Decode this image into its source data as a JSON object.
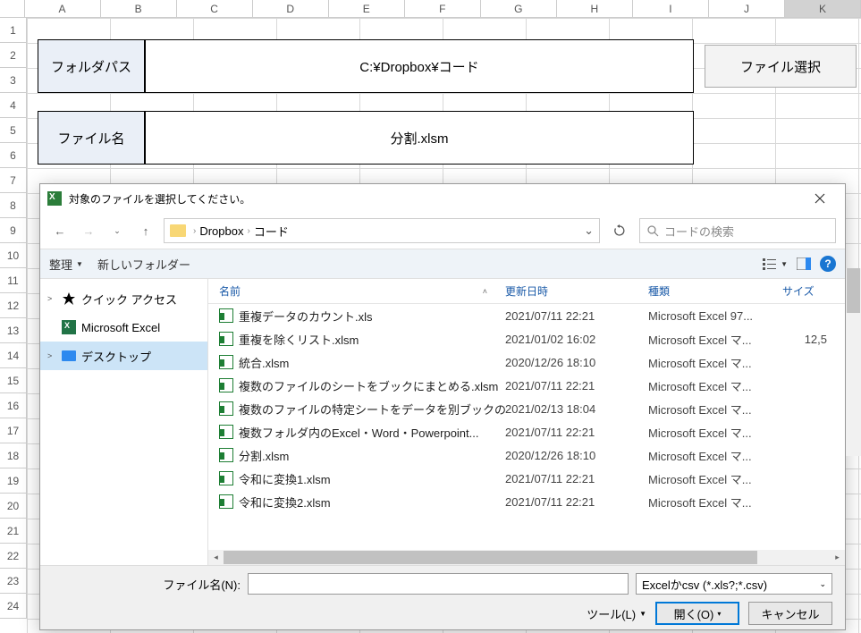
{
  "columns": [
    "A",
    "B",
    "C",
    "D",
    "E",
    "F",
    "G",
    "H",
    "I",
    "J",
    "K"
  ],
  "selected_column": "K",
  "rows": [
    "1",
    "2",
    "3",
    "4",
    "5",
    "6",
    "7",
    "8",
    "9",
    "10",
    "11",
    "12",
    "13",
    "14",
    "15",
    "16",
    "17",
    "18",
    "19",
    "20",
    "21",
    "22",
    "23",
    "24"
  ],
  "sheet": {
    "folder_path_label": "フォルダパス",
    "folder_path_value": "C:¥Dropbox¥コード",
    "file_select_button": "ファイル選択",
    "file_name_label": "ファイル名",
    "file_name_value": "分割.xlsm"
  },
  "dialog": {
    "title": "対象のファイルを選択してください。",
    "breadcrumb": {
      "parts": [
        "Dropbox",
        "コード"
      ]
    },
    "search_placeholder": "コードの検索",
    "toolbar": {
      "organize": "整理",
      "new_folder": "新しいフォルダー"
    },
    "sidebar": {
      "items": [
        {
          "label": "クイック アクセス",
          "icon": "star",
          "expandable": true
        },
        {
          "label": "Microsoft Excel",
          "icon": "excel",
          "expandable": false
        },
        {
          "label": "デスクトップ",
          "icon": "desktop",
          "expandable": true,
          "selected": true
        }
      ]
    },
    "headers": {
      "name": "名前",
      "date": "更新日時",
      "type": "種類",
      "size": "サイズ"
    },
    "files": [
      {
        "name": "重複データのカウント.xls",
        "date": "2021/07/11 22:21",
        "type": "Microsoft Excel 97...",
        "size": ""
      },
      {
        "name": "重複を除くリスト.xlsm",
        "date": "2021/01/02 16:02",
        "type": "Microsoft Excel マ...",
        "size": "12,5"
      },
      {
        "name": "統合.xlsm",
        "date": "2020/12/26 18:10",
        "type": "Microsoft Excel マ...",
        "size": ""
      },
      {
        "name": "複数のファイルのシートをブックにまとめる.xlsm",
        "date": "2021/07/11 22:21",
        "type": "Microsoft Excel マ...",
        "size": ""
      },
      {
        "name": "複数のファイルの特定シートをデータを別ブックの...",
        "date": "2021/02/13 18:04",
        "type": "Microsoft Excel マ...",
        "size": ""
      },
      {
        "name": "複数フォルダ内のExcel・Word・Powerpoint...",
        "date": "2021/07/11 22:21",
        "type": "Microsoft Excel マ...",
        "size": ""
      },
      {
        "name": "分割.xlsm",
        "date": "2020/12/26 18:10",
        "type": "Microsoft Excel マ...",
        "size": ""
      },
      {
        "name": "令和に変換1.xlsm",
        "date": "2021/07/11 22:21",
        "type": "Microsoft Excel マ...",
        "size": ""
      },
      {
        "name": "令和に変換2.xlsm",
        "date": "2021/07/11 22:21",
        "type": "Microsoft Excel マ...",
        "size": ""
      }
    ],
    "footer": {
      "filename_label": "ファイル名(N):",
      "filename_value": "",
      "filter": "Excelかcsv (*.xls?;*.csv)",
      "tools": "ツール(L)",
      "open": "開く(O)",
      "cancel": "キャンセル"
    }
  }
}
